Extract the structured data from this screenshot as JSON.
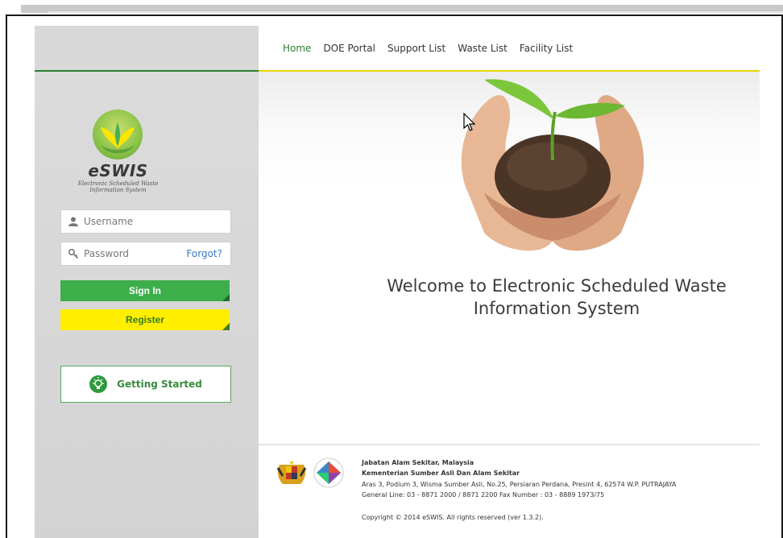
{
  "nav": {
    "items": [
      {
        "label": "Home",
        "active": true
      },
      {
        "label": "DOE Portal",
        "active": false
      },
      {
        "label": "Support List",
        "active": false
      },
      {
        "label": "Waste List",
        "active": false
      },
      {
        "label": "Facility List",
        "active": false
      }
    ]
  },
  "logo": {
    "title": "eSWIS",
    "subtitle_line1": "Electronic Scheduled Waste",
    "subtitle_line2": "Information System"
  },
  "login": {
    "username_placeholder": "Username",
    "password_placeholder": "Password",
    "forgot_label": "Forgot?",
    "signin_label": "Sign In",
    "register_label": "Register"
  },
  "getting_started": {
    "label": "Getting Started"
  },
  "hero": {
    "welcome_line1": "Welcome to Electronic Scheduled Waste",
    "welcome_line2": "Information System"
  },
  "footer": {
    "org_name": "Jabatan Alam Sekitar, Malaysia",
    "ministry": "Kementerian Sumber Asli Dan Alam Sekitar",
    "address": "Aras 3, Podium 3, Wisma Sumber Asli, No.25, Persiaran Perdana, Presint 4, 62574 W.P. PUTRAJAYA",
    "contact": "General Line: 03 - 8871 2000 / 8871 2200 Fax Number : 03 - 8889 1973/75",
    "copyright": "Copyright © 2014 eSWIS. All rights reserved (ver 1.3.2)."
  },
  "colors": {
    "brand_green": "#3cae4a",
    "register_yellow": "#ffee00",
    "nav_active": "#2e7d32",
    "nav_underline": "#e8d700",
    "link_blue": "#3b78c2"
  },
  "icons": {
    "username": "user-icon",
    "password": "key-icon",
    "getting_started": "lightbulb-icon",
    "cursor": "mouse-pointer-icon"
  }
}
